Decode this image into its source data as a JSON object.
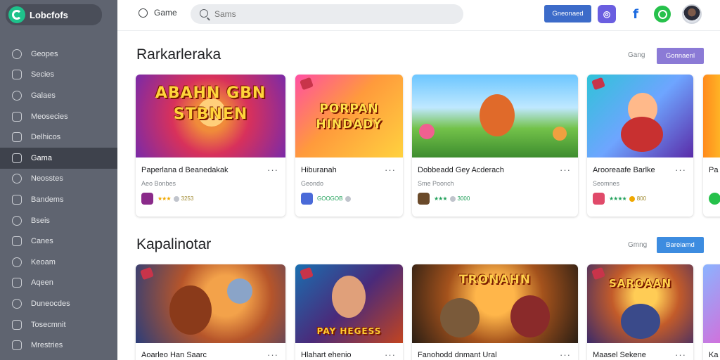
{
  "app": {
    "logo_text": "Lobcfofs"
  },
  "sidebar": {
    "items": [
      {
        "label": "Geopes",
        "icon": "compass-icon"
      },
      {
        "label": "Secies",
        "icon": "grid-icon"
      },
      {
        "label": "Galaes",
        "icon": "gamepad-icon"
      },
      {
        "label": "Meosecies",
        "icon": "shield-icon"
      },
      {
        "label": "Delhicos",
        "icon": "puzzle-icon"
      },
      {
        "label": "Gama",
        "icon": "list-icon",
        "active": true
      },
      {
        "label": "Neosstes",
        "icon": "globe-icon"
      },
      {
        "label": "Bandems",
        "icon": "book-icon"
      },
      {
        "label": "Bseis",
        "icon": "target-icon"
      },
      {
        "label": "Canes",
        "icon": "chat-icon"
      },
      {
        "label": "Keoam",
        "icon": "clock-icon"
      },
      {
        "label": "Aqeen",
        "icon": "star-icon"
      },
      {
        "label": "Duneocdes",
        "icon": "trophy-icon"
      },
      {
        "label": "Tosecmnit",
        "icon": "card-icon"
      },
      {
        "label": "Mrestries",
        "icon": "bookmark-icon"
      }
    ]
  },
  "header": {
    "home_label": "Game",
    "search_placeholder": "Sams",
    "action_button": "Gneonaed",
    "social_icons": [
      "instagram-icon",
      "facebook-icon",
      "whatsapp-icon"
    ]
  },
  "sections": [
    {
      "title": "Rarkarleraka",
      "see_all": "Gang",
      "button": "Gonnaenl",
      "button_color": "#8b7ad6",
      "cards": [
        {
          "thumb_text": "ABAHN GBN STBNEN",
          "title": "Paperlana d Beanedakak",
          "sub": "Aeo Bonbes",
          "rating": "★★★",
          "meta": "3253",
          "star_color": "gold"
        },
        {
          "thumb_text": "PORPAN HINDADY",
          "title": "Hiburanah",
          "sub": "Geondo",
          "rating": "",
          "meta": "GOOGOB",
          "star_color": "gold"
        },
        {
          "thumb_text": "",
          "title": "Dobbeadd Gey Acderach",
          "sub": "Sme Poonch",
          "rating": "★★★",
          "meta": "3000",
          "star_color": "green"
        },
        {
          "thumb_text": "",
          "title": "Arooreaafe Barlke",
          "sub": "Seomnes",
          "rating": "★★★★",
          "meta": "800",
          "star_color": "green"
        },
        {
          "thumb_text": "",
          "title": "Pa",
          "sub": "",
          "rating": "",
          "meta": "",
          "star_color": "green"
        }
      ]
    },
    {
      "title": "Kapalinotar",
      "see_all": "Gmng",
      "button": "Bareiamd",
      "button_color": "#3d8ce0",
      "cards": [
        {
          "thumb_text": "",
          "title": "Aoarleo Han Saarc"
        },
        {
          "thumb_text": "PAY HEGESS",
          "title": "Hlahart ehenio"
        },
        {
          "thumb_text": "TRONAHN",
          "title": "Fanohodd dnmant Ural"
        },
        {
          "thumb_text": "SAROAAN",
          "title": "Maasel Sekene"
        },
        {
          "thumb_text": "",
          "title": "Ka"
        }
      ]
    }
  ]
}
